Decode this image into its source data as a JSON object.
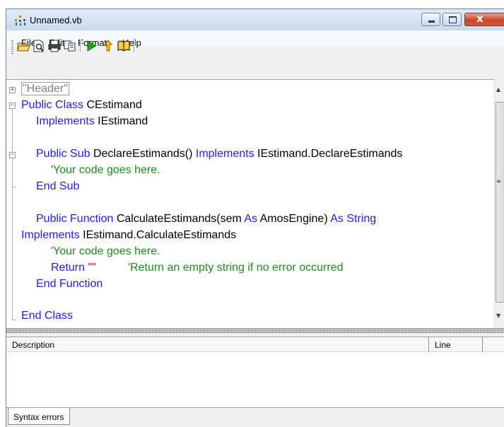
{
  "window": {
    "title": "Unnamed.vb",
    "close_symbol": "x"
  },
  "menu": [
    "File",
    "Edit",
    "Format",
    "Help"
  ],
  "toolbar": {
    "icons": [
      "open-folder-icon",
      "print-preview-icon",
      "print-icon",
      "copy-icon",
      "run-icon",
      "step-icon",
      "help-book-icon"
    ]
  },
  "editor": {
    "lines": {
      "l1": "\"Header\"",
      "l2_kw": "Public Class ",
      "l2_name": "CEstimand",
      "l3_kw": "Implements ",
      "l3_name": "IEstimand",
      "l5_kw": "Public Sub ",
      "l5_name": "DeclareEstimands() ",
      "l5_kw2": "Implements ",
      "l5_name2": "IEstimand.DeclareEstimands",
      "l6": "'Your code goes here.",
      "l7": "End Sub",
      "l9_kw": "Public Function ",
      "l9_name": "CalculateEstimands(sem ",
      "l9_kw2": "As ",
      "l9_name2": "AmosEngine) ",
      "l9_kw3": "As String",
      "l10_kw": "Implements ",
      "l10_name": "IEstimand.CalculateEstimands",
      "l11": "'Your code goes here.",
      "l12_kw": "Return ",
      "l12_str": "\"\"",
      "l12_cm": "'Return an empty string if no error occurred",
      "l13": "End Function",
      "l15": "End Class"
    }
  },
  "errors": {
    "columns": [
      "Description",
      "Line"
    ],
    "tab_label": "Syntax errors"
  },
  "colors": {
    "keyword": "#1f1fdc",
    "comment": "#1e8a1e",
    "string": "#a31515"
  }
}
